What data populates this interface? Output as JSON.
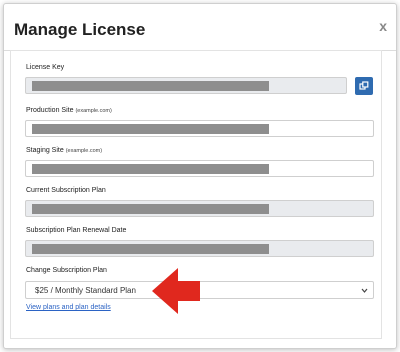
{
  "modal": {
    "title": "Manage License",
    "close_label": "x"
  },
  "fields": {
    "license_key": {
      "label": "License Key"
    },
    "production_site": {
      "label": "Production Site",
      "hint": "(example.com)"
    },
    "staging_site": {
      "label": "Staging Site",
      "hint": "(example.com)"
    },
    "current_plan": {
      "label": "Current Subscription Plan"
    },
    "renewal_date": {
      "label": "Subscription Plan Renewal Date"
    },
    "change_plan": {
      "label": "Change Subscription Plan",
      "selected": "$25 / Monthly Standard Plan"
    }
  },
  "link": {
    "plans_label": "View plans and plan details"
  },
  "colors": {
    "accent": "#2f6bb0",
    "arrow": "#e0281e",
    "redaction": "#8e8e8e",
    "readonly_bg": "#e9ebee"
  },
  "icons": {
    "copy": "copy-icon",
    "dropdown": "chevron-down-icon",
    "annotation": "arrow-left-icon"
  }
}
